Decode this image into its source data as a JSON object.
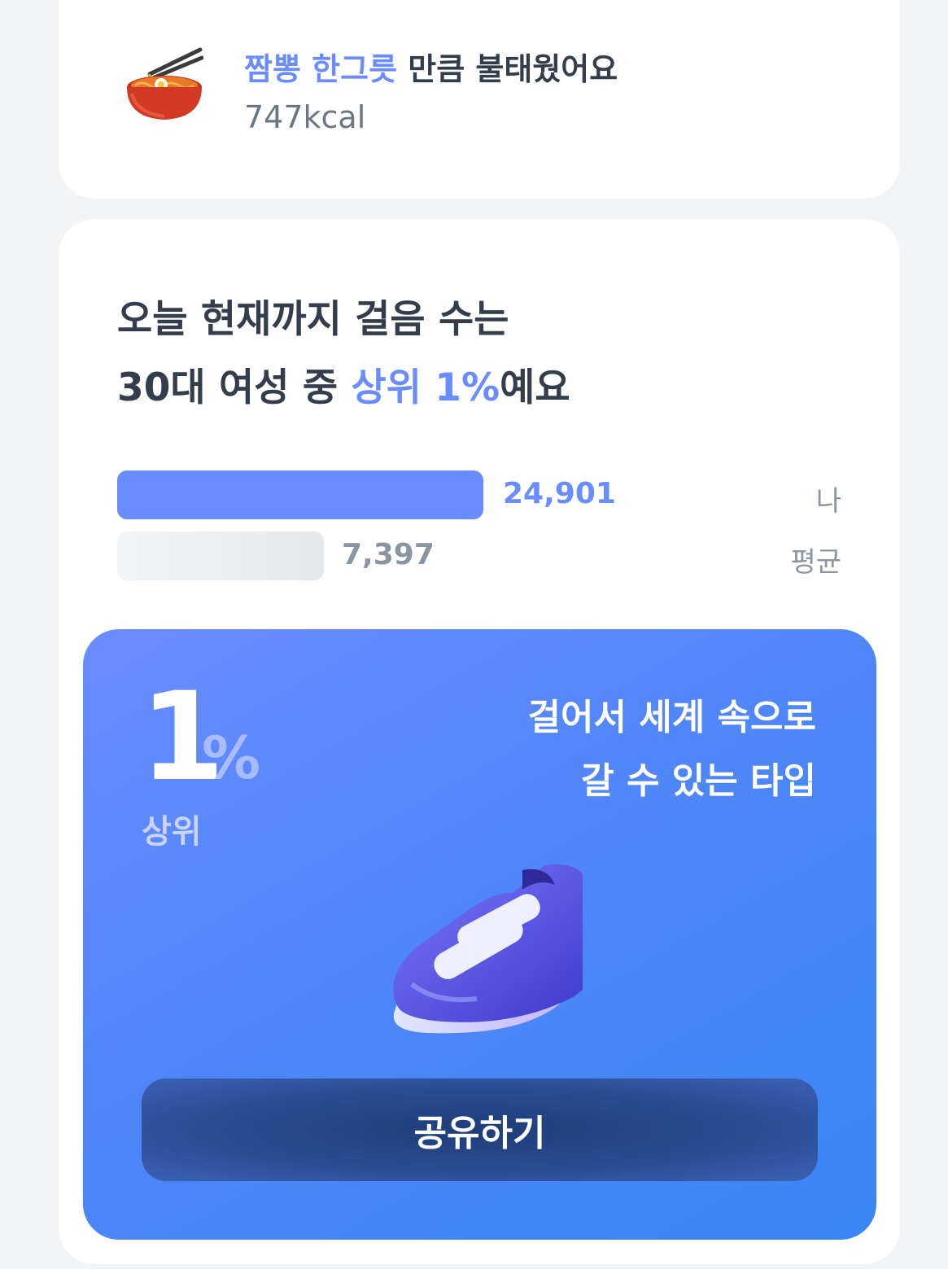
{
  "food_card": {
    "highlight": "짬뽕 한그릇",
    "title_rest": " 만큼 불태웠어요",
    "kcal": "747kcal",
    "icon": "noodle-bowl-icon"
  },
  "steps_card": {
    "headline_line1": "오늘 현재까지 걸음 수는",
    "headline_line2_prefix": "30대 여성 중 ",
    "headline_line2_highlight": "상위 1%",
    "headline_line2_suffix": "예요",
    "comparison": [
      {
        "label": "나",
        "value": "24,901",
        "steps": 24901,
        "color": "#6b8cff"
      },
      {
        "label": "평균",
        "value": "7,397",
        "steps": 7397,
        "color": "#e5e8eb"
      }
    ]
  },
  "rank_card": {
    "rank_number": "1",
    "rank_unit": "%",
    "rank_label": "상위",
    "desc_line1": "걸어서 세계 속으로",
    "desc_line2": "갈 수 있는 타입",
    "illustration": "sneaker-icon",
    "share_label": "공유하기"
  },
  "colors": {
    "accent": "#6b8cff",
    "text": "#333d4b",
    "card_gradient_start": "#6b8cff",
    "card_gradient_end": "#3a86f5",
    "button": "#2b4d93"
  }
}
